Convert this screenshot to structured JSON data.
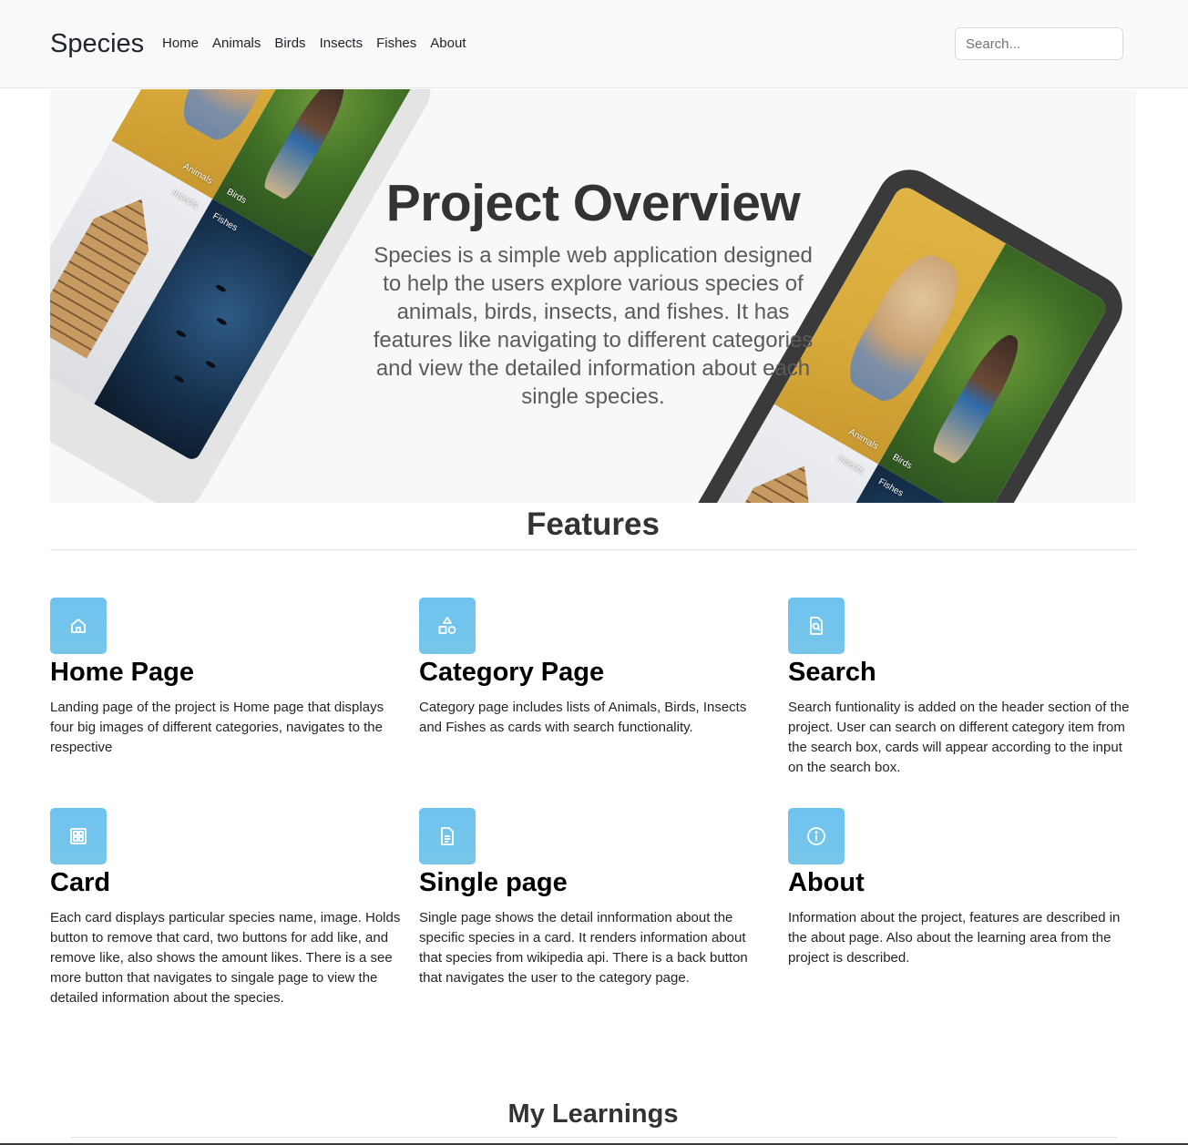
{
  "navbar": {
    "brand": "Species",
    "links": [
      "Home",
      "Animals",
      "Birds",
      "Insects",
      "Fishes",
      "About"
    ],
    "search_placeholder": "Search..."
  },
  "hero": {
    "title": "Project Overview",
    "description": "Species is a simple web application designed to help the users explore various species of animals, birds, insects, and fishes. It has features like navigating to different categories and view the detailed information about each single species.",
    "image_labels": {
      "animals": "Animals",
      "birds": "Birds",
      "insects": "Insects",
      "fishes": "Fishes"
    }
  },
  "features": {
    "heading": "Features",
    "items": [
      {
        "icon": "home-icon",
        "title": "Home Page",
        "desc": "Landing page of the project is Home page that displays four big images of different categories, navigates to the respective"
      },
      {
        "icon": "shapes-icon",
        "title": "Category Page",
        "desc": "Category page includes lists of Animals, Birds, Insects and Fishes as cards with search functionality."
      },
      {
        "icon": "file-search-icon",
        "title": "Search",
        "desc": "Search funtionality is added on the header section of the project. User can search on different category item from the search box, cards will appear according to the input on the search box."
      },
      {
        "icon": "grid-icon",
        "title": "Card",
        "desc": "Each card displays particular species name, image. Holds button to remove that card, two buttons for add like, and remove like, also shows the amount likes. There is a see more button that navigates to singale page to view the detailed information about the species."
      },
      {
        "icon": "document-icon",
        "title": "Single page",
        "desc": "Single page shows the detail innformation about the specific species in a card. It renders information about that species from wikipedia api. There is a back button that navigates the user to the category page."
      },
      {
        "icon": "info-icon",
        "title": "About",
        "desc": "Information about the project, features are described in the about page. Also about the learning area from the project is described."
      }
    ]
  },
  "learnings": {
    "heading": "My Learnings"
  },
  "colors": {
    "icon_bg": "#6ec3ee",
    "navbar_bg": "#f8f9fa",
    "hero_bg": "#f7f8fa"
  }
}
